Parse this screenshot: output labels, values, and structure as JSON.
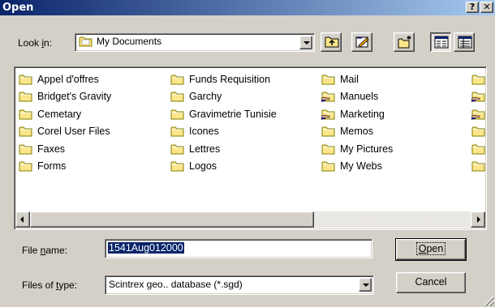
{
  "title": "Open",
  "caption_buttons": {
    "help": "?",
    "close": "✕"
  },
  "look_in": {
    "label_pre": "Look ",
    "label_key": "i",
    "label_post": "n:",
    "value": "My Documents"
  },
  "toolbar": {
    "buttons": [
      {
        "name": "up-one-level",
        "icon": "folder-up-icon"
      },
      {
        "name": "view-desktop",
        "icon": "pencil-desk-icon"
      },
      {
        "name": "create-new-folder",
        "icon": "new-folder-icon"
      },
      {
        "name": "list-view",
        "icon": "list-view-icon",
        "pressed": true
      },
      {
        "name": "details-view",
        "icon": "details-view-icon",
        "pressed": false
      }
    ]
  },
  "files": {
    "columns": [
      [
        {
          "label": "Appel d'offres",
          "icon": "folder"
        },
        {
          "label": "Bridget's Gravity",
          "icon": "folder"
        },
        {
          "label": "Cemetary",
          "icon": "folder"
        },
        {
          "label": "Corel User Files",
          "icon": "folder"
        },
        {
          "label": "Faxes",
          "icon": "folder"
        },
        {
          "label": "Forms",
          "icon": "folder"
        }
      ],
      [
        {
          "label": "Funds Requisition",
          "icon": "folder"
        },
        {
          "label": "Garchy",
          "icon": "folder"
        },
        {
          "label": "Gravimetrie Tunisie",
          "icon": "folder"
        },
        {
          "label": "Icones",
          "icon": "folder"
        },
        {
          "label": "Lettres",
          "icon": "folder"
        },
        {
          "label": "Logos",
          "icon": "folder"
        }
      ],
      [
        {
          "label": "Mail",
          "icon": "folder"
        },
        {
          "label": "Manuels",
          "icon": "shared-folder"
        },
        {
          "label": "Marketing",
          "icon": "shared-folder"
        },
        {
          "label": "Memos",
          "icon": "folder"
        },
        {
          "label": "My Pictures",
          "icon": "folder"
        },
        {
          "label": "My Webs",
          "icon": "folder"
        }
      ],
      [
        {
          "label": "",
          "icon": "folder"
        },
        {
          "label": "",
          "icon": "shared-folder"
        },
        {
          "label": "",
          "icon": "shared-folder"
        },
        {
          "label": "",
          "icon": "folder"
        },
        {
          "label": "",
          "icon": "folder"
        },
        {
          "label": "",
          "icon": "folder"
        }
      ]
    ]
  },
  "file_name": {
    "label_pre": "File ",
    "label_key": "n",
    "label_post": "ame:",
    "value": "1541Aug012000"
  },
  "file_type": {
    "label_pre": "Files of ",
    "label_key": "t",
    "label_post": "ype:",
    "value": "Scintrex geo.. database (*.sgd)"
  },
  "buttons": {
    "open_key": "O",
    "open_rest": "pen",
    "cancel": "Cancel"
  },
  "colors": {
    "title_start": "#0a246a",
    "title_end": "#a6caf0",
    "face": "#d4d0c8",
    "folder": "#fde58a",
    "selection": "#0a246a"
  }
}
